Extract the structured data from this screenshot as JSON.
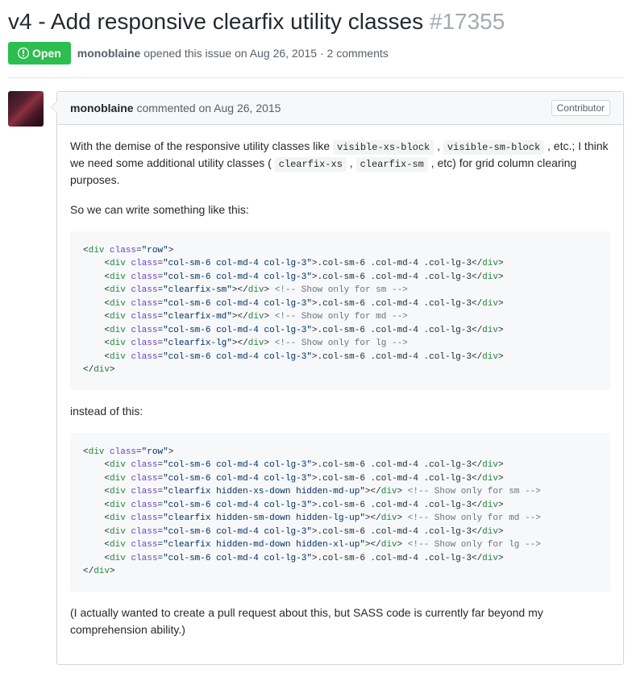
{
  "issue": {
    "title": "v4 - Add responsive clearfix utility classes",
    "number": "#17355",
    "state": "Open",
    "author": "monoblaine",
    "opened_text": " opened this issue on Aug 26, 2015 · 2 comments"
  },
  "comment": {
    "author": "monoblaine",
    "action": " commented on Aug 26, 2015",
    "badge": "Contributor",
    "p1_a": "With the demise of the responsive utility classes like ",
    "p1_code1": "visible-xs-block",
    "p1_b": " , ",
    "p1_code2": "visible-sm-block",
    "p1_c": " , etc.; I think we need some additional utility classes ( ",
    "p1_code3": "clearfix-xs",
    "p1_d": " , ",
    "p1_code4": "clearfix-sm",
    "p1_e": " , etc) for grid column clearing purposes.",
    "p2": "So we can write something like this:",
    "p3": "instead of this:",
    "p4": "(I actually wanted to create a pull request about this, but SASS code is currently far beyond my comprehension ability.)"
  },
  "code1": {
    "row_open": "row",
    "col_classes": "col-sm-6 col-md-4 col-lg-3",
    "col_text": ".col-sm-6 .col-md-4 .col-lg-3",
    "cf_sm": "clearfix-sm",
    "cf_md": "clearfix-md",
    "cf_lg": "clearfix-lg",
    "cmt_sm": " Show only for sm ",
    "cmt_md": " Show only for md ",
    "cmt_lg": " Show only for lg "
  },
  "code2": {
    "cf_sm": "clearfix hidden-xs-down hidden-md-up",
    "cf_md": "clearfix hidden-sm-down hidden-lg-up",
    "cf_lg": "clearfix hidden-md-down hidden-xl-up"
  },
  "tokens": {
    "div": "div",
    "class": "class",
    "lt": "<",
    "gt": ">",
    "lte": "</",
    "eq": "=",
    "q": "\"",
    "cmt_open": "<!--",
    "cmt_close": "-->"
  }
}
